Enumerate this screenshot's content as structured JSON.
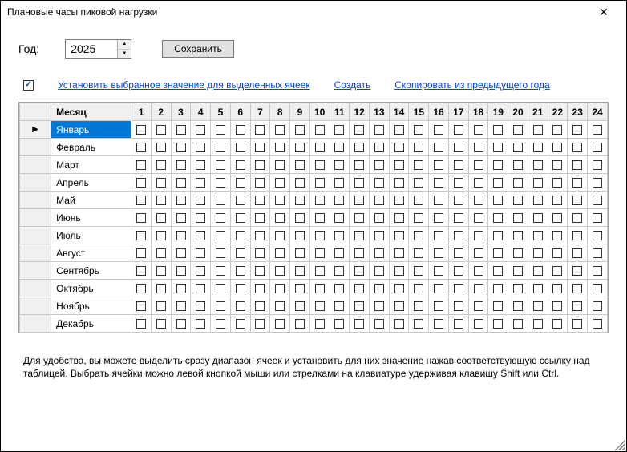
{
  "window": {
    "title": "Плановые часы пиковой нагрузки"
  },
  "controls": {
    "year_label": "Год:",
    "year_value": "2025",
    "save_label": "Сохранить"
  },
  "actions": {
    "checkbox_checked": true,
    "set_value_link": "Установить выбранное значение для выделенных ячеек",
    "create_link": "Создать",
    "copy_prev_year_link": "Скопировать из предыдущего года"
  },
  "grid": {
    "month_header": "Месяц",
    "hours": [
      "1",
      "2",
      "3",
      "4",
      "5",
      "6",
      "7",
      "8",
      "9",
      "10",
      "11",
      "12",
      "13",
      "14",
      "15",
      "16",
      "17",
      "18",
      "19",
      "20",
      "21",
      "22",
      "23",
      "24"
    ],
    "rows": [
      {
        "month": "Январь",
        "selected": true,
        "current": true
      },
      {
        "month": "Февраль"
      },
      {
        "month": "Март"
      },
      {
        "month": "Апрель"
      },
      {
        "month": "Май"
      },
      {
        "month": "Июнь"
      },
      {
        "month": "Июль"
      },
      {
        "month": "Август"
      },
      {
        "month": "Сентябрь"
      },
      {
        "month": "Октябрь"
      },
      {
        "month": "Ноябрь"
      },
      {
        "month": "Декабрь"
      }
    ]
  },
  "help_text": "Для удобства, вы можете выделить сразу диапазон ячеек и установить для них значение нажав соответствующую ссылку над таблицей. Выбрать ячейки можно левой кнопкой мыши или стрелками на клавиатуре удерживая клавишу Shift или Ctrl."
}
